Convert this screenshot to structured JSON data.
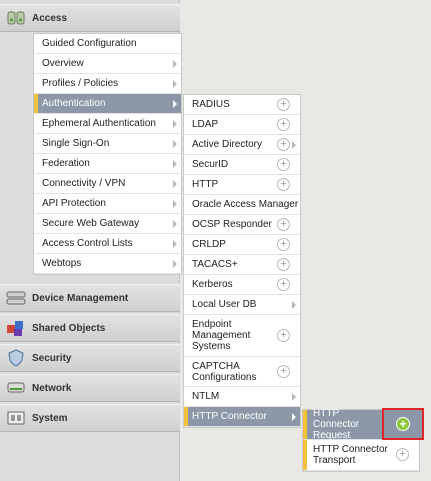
{
  "nav_sections": {
    "access": "Access",
    "device_management": "Device Management",
    "shared_objects": "Shared Objects",
    "security": "Security",
    "network": "Network",
    "system": "System"
  },
  "access_menu": [
    "Guided Configuration",
    "Overview",
    "Profiles / Policies",
    "Authentication",
    "Ephemeral Authentication",
    "Single Sign-On",
    "Federation",
    "Connectivity / VPN",
    "API Protection",
    "Secure Web Gateway",
    "Access Control Lists",
    "Webtops"
  ],
  "auth_menu": [
    "RADIUS",
    "LDAP",
    "Active Directory",
    "SecurID",
    "HTTP",
    "Oracle Access Manager",
    "OCSP Responder",
    "CRLDP",
    "TACACS+",
    "Kerberos",
    "Local User DB",
    "Endpoint Management Systems",
    "CAPTCHA Configurations",
    "NTLM",
    "HTTP Connector"
  ],
  "http_connector_menu": [
    "HTTP Connector Request",
    "HTTP Connector Transport"
  ],
  "colors": {
    "active_row": "#8c98a8",
    "accent_yellow": "#f3c23c",
    "highlight_red": "#e0262b",
    "plus_green": "#8dc63f"
  }
}
